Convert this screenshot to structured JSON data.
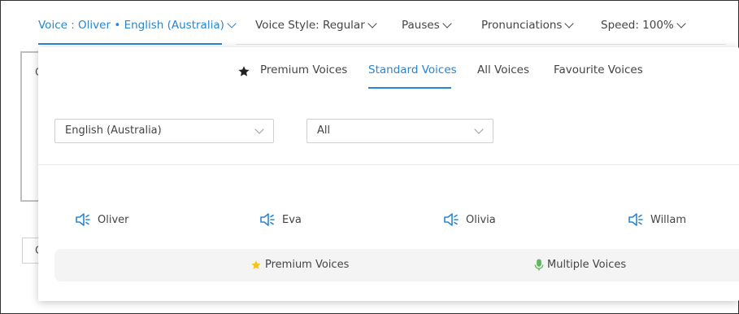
{
  "toolbar": {
    "voice_label": "Voice : Oliver • English (Australia)",
    "style_label": "Voice Style: Regular",
    "pauses_label": "Pauses",
    "pronunciations_label": "Pronunciations",
    "speed_label": "Speed: 100%"
  },
  "background": {
    "editor_letter": "C",
    "small_letter": "C"
  },
  "panel": {
    "tabs": [
      {
        "label": "Premium Voices",
        "icon": "star-icon"
      },
      {
        "label": "Standard Voices",
        "active": true
      },
      {
        "label": "All Voices"
      },
      {
        "label": "Favourite Voices"
      }
    ],
    "language_select": {
      "value": "English (Australia)"
    },
    "filter_select": {
      "value": "All"
    },
    "voices": [
      {
        "name": "Oliver",
        "icon": "speaker-icon"
      },
      {
        "name": "Eva",
        "icon": "speaker-icon"
      },
      {
        "name": "Olivia",
        "icon": "speaker-icon"
      },
      {
        "name": "Willam",
        "icon": "speaker-icon"
      }
    ],
    "legend": {
      "premium_label": "Premium Voices",
      "multiple_label": "Multiple Voices"
    }
  },
  "colors": {
    "accent": "#2a85d0",
    "star_gold": "#f5c518",
    "mic_green": "#5cb85c"
  }
}
